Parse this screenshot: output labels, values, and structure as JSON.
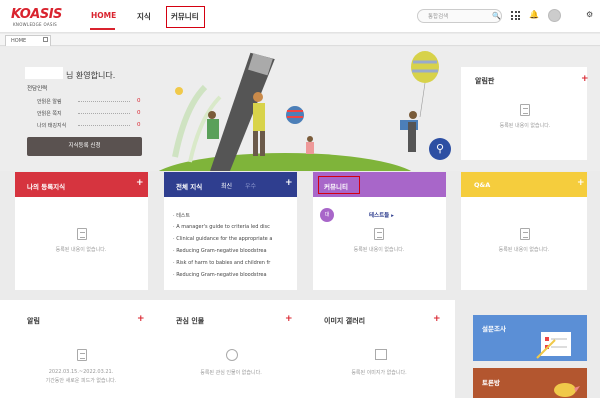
{
  "header": {
    "logo": "KOASIS",
    "logo_sub": "KNOWLEDGE OASIS",
    "nav": [
      "HOME",
      "지식",
      "커뮤니티"
    ],
    "search_placeholder": "통합검색"
  },
  "tab": {
    "label": "HOME"
  },
  "hero": {
    "welcome": "님 환영합니다.",
    "role": "전담인력",
    "stats": [
      {
        "label": "안읽은 알림",
        "value": "0"
      },
      {
        "label": "안읽은 쪽지",
        "value": "0"
      },
      {
        "label": "나의 태깅지식",
        "value": "0"
      }
    ],
    "register_button": "지식등록 신청"
  },
  "notice": {
    "title": "알림판",
    "plus": "+",
    "empty": "등록된 내용이 없습니다."
  },
  "cards": {
    "my_knowledge": {
      "title": "나의 등록지식",
      "plus": "+",
      "empty": "등록된 내용이 없습니다."
    },
    "all_knowledge": {
      "title": "전체 지식",
      "tabs": [
        "최신",
        "우수"
      ],
      "plus": "+",
      "items": [
        "테스트",
        "A manager's guide to criteria led disc",
        "Clinical guidance for the appropriate a",
        "Reducing Gram-negative bloodstrea",
        "Risk of harm to babies and children fr",
        "Reducing Gram-negative bloodstrea"
      ]
    },
    "community": {
      "title": "커뮤니티",
      "badge": "대",
      "link": "테스트들",
      "empty": "등록된 내용이 없습니다."
    },
    "qa": {
      "title": "Q&A",
      "plus": "+",
      "empty": "등록된 내용이 없습니다."
    }
  },
  "bottom": {
    "alarm": {
      "title": "알림",
      "plus": "+",
      "line1": "2022.03.15.~2022.03.21.",
      "line2": "기간동안 새로운 피드가 없습니다."
    },
    "interest": {
      "title": "관심 인물",
      "plus": "+",
      "empty": "등록된 관심 인물이 없습니다."
    },
    "gallery": {
      "title": "이미지 갤러리",
      "plus": "+",
      "empty": "등록된 이미지가 없습니다."
    },
    "survey": {
      "title": "설문조사"
    },
    "forum": {
      "title": "토론방"
    }
  },
  "colors": {
    "brand": "#d9232e",
    "my_knowledge": "#d6343f",
    "all_knowledge": "#2f3e8f",
    "community": "#a866c9",
    "qa": "#f5cd3d",
    "survey": "#5b8fd6",
    "forum": "#b3562f"
  }
}
